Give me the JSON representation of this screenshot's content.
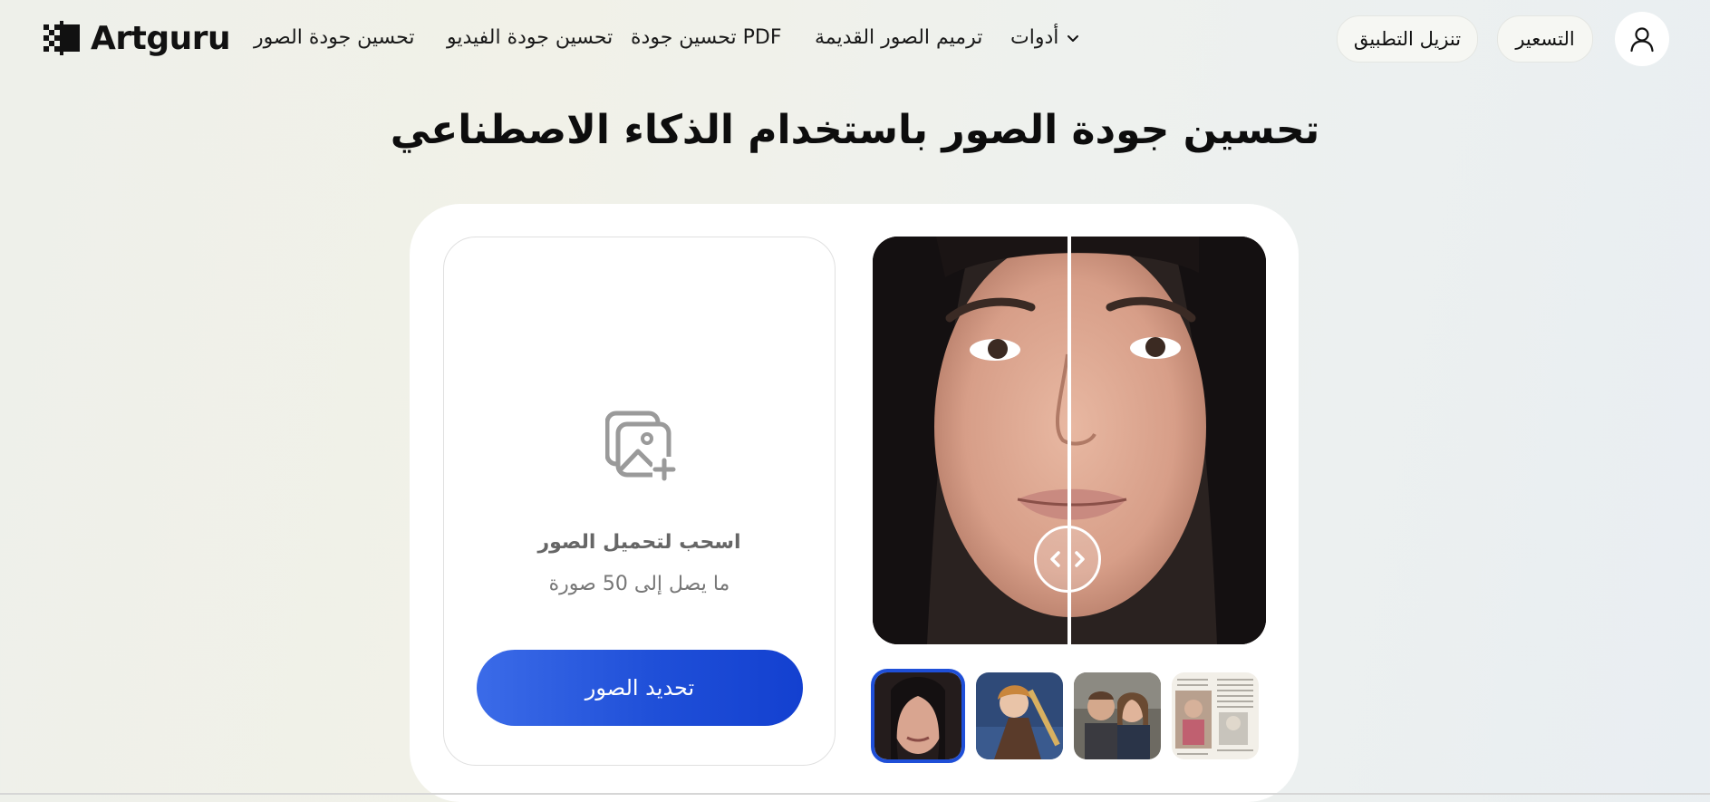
{
  "brand": {
    "name": "Artguru"
  },
  "nav": {
    "items": [
      {
        "label": "تحسين جودة الصور"
      },
      {
        "label": "تحسين جودة الفيديو"
      },
      {
        "label": "تحسين جودة PDF"
      },
      {
        "label": "ترميم الصور القديمة"
      }
    ],
    "tools_label": "أدوات",
    "tools_icon": "chevron-down-icon"
  },
  "header_actions": {
    "download_app": "تنزيل التطبيق",
    "pricing": "التسعير",
    "account_icon": "user-icon"
  },
  "page": {
    "title": "تحسين جودة الصور باستخدام الذكاء الاصطناعي"
  },
  "upload": {
    "icon": "add-image-icon",
    "drag_title": "اسحب لتحميل الصور",
    "limit_text": "ما يصل إلى 50 صورة",
    "button_label": "تحديد الصور"
  },
  "preview": {
    "compare_handle_icon": "left-right-arrows-icon",
    "thumbnails": [
      {
        "name": "portrait-woman",
        "active": true
      },
      {
        "name": "anime-girl",
        "active": false
      },
      {
        "name": "couple-photo",
        "active": false
      },
      {
        "name": "newspaper-collage",
        "active": false
      }
    ]
  },
  "colors": {
    "accent": "#1f4fd8",
    "text": "#111111",
    "muted": "#777777"
  }
}
